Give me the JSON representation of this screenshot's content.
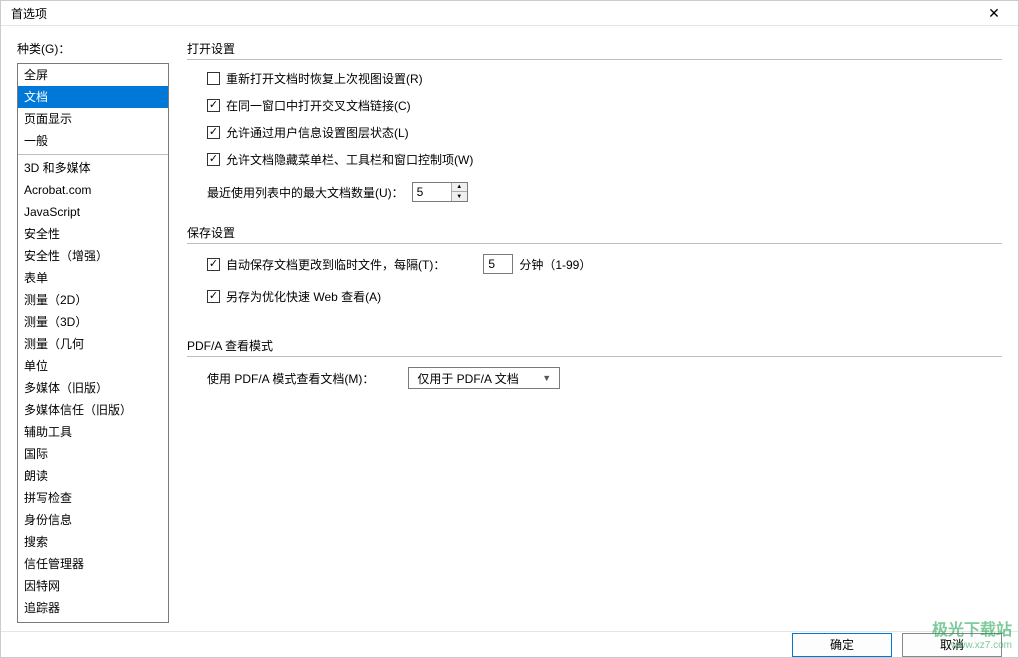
{
  "window": {
    "title": "首选项",
    "close": "✕"
  },
  "sidebar": {
    "label": "种类(G)：",
    "group1": [
      "全屏",
      "文档",
      "页面显示",
      "一般"
    ],
    "selectedIndex": 1,
    "group2": [
      "3D 和多媒体",
      "Acrobat.com",
      "JavaScript",
      "安全性",
      "安全性（增强）",
      "表单",
      "测量（2D）",
      "测量（3D）",
      "测量（几何",
      "单位",
      "多媒体（旧版）",
      "多媒体信任（旧版）",
      "辅助工具",
      "国际",
      "朗读",
      "拼写检查",
      "身份信息",
      "搜索",
      "信任管理器",
      "因特网",
      "追踪器"
    ]
  },
  "open": {
    "title": "打开设置",
    "restore": {
      "label": "重新打开文档时恢复上次视图设置(R)",
      "checked": false
    },
    "sameWin": {
      "label": "在同一窗口中打开交叉文档链接(C)",
      "checked": true
    },
    "layerState": {
      "label": "允许通过用户信息设置图层状态(L)",
      "checked": true
    },
    "hideUI": {
      "label": "允许文档隐藏菜单栏、工具栏和窗口控制项(W)",
      "checked": true
    },
    "recent": {
      "label": "最近使用列表中的最大文档数量(U)：",
      "value": "5"
    }
  },
  "save": {
    "title": "保存设置",
    "autosave": {
      "label_prefix": "自动保存文档更改到临时文件，每隔(T)：",
      "value": "5",
      "label_suffix": "分钟（1-99）",
      "checked": true
    },
    "fastweb": {
      "label": "另存为优化快速 Web 查看(A)",
      "checked": true
    }
  },
  "pdfa": {
    "title": "PDF/A 查看模式",
    "label": "使用 PDF/A 模式查看文档(M)：",
    "selected": "仅用于 PDF/A 文档"
  },
  "footer": {
    "ok": "确定",
    "cancel": "取消"
  },
  "watermark": {
    "main": "极光下载站",
    "sub": "www.xz7.com"
  }
}
